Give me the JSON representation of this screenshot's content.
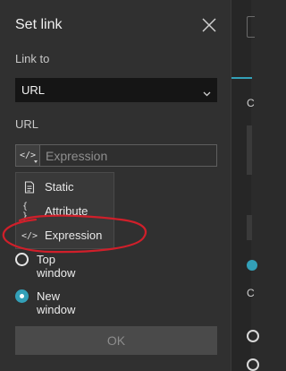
{
  "dialog": {
    "title": "Set link",
    "close_icon": "close-icon",
    "link_to_label": "Link to",
    "link_to_value": "URL",
    "url_label": "URL",
    "url_placeholder": "Expression",
    "expression_button_glyph": "</>",
    "ok_label": "OK"
  },
  "menu": {
    "items": [
      {
        "label": "Static",
        "icon": "document-icon",
        "glyph": "🗎"
      },
      {
        "label": "Attribute",
        "icon": "braces-icon",
        "glyph": "{ }"
      },
      {
        "label": "Expression",
        "icon": "code-icon",
        "glyph": "</>"
      }
    ]
  },
  "open_in": {
    "options": [
      {
        "label": "Top window",
        "selected": false
      },
      {
        "label": "New window",
        "selected": true
      }
    ]
  },
  "right_strip": {
    "label_c1": "C",
    "label_c2": "C"
  },
  "colors": {
    "accent": "#33a0b8",
    "annotation": "#d01f2a",
    "panel": "#303030",
    "select_bg": "#151515"
  }
}
